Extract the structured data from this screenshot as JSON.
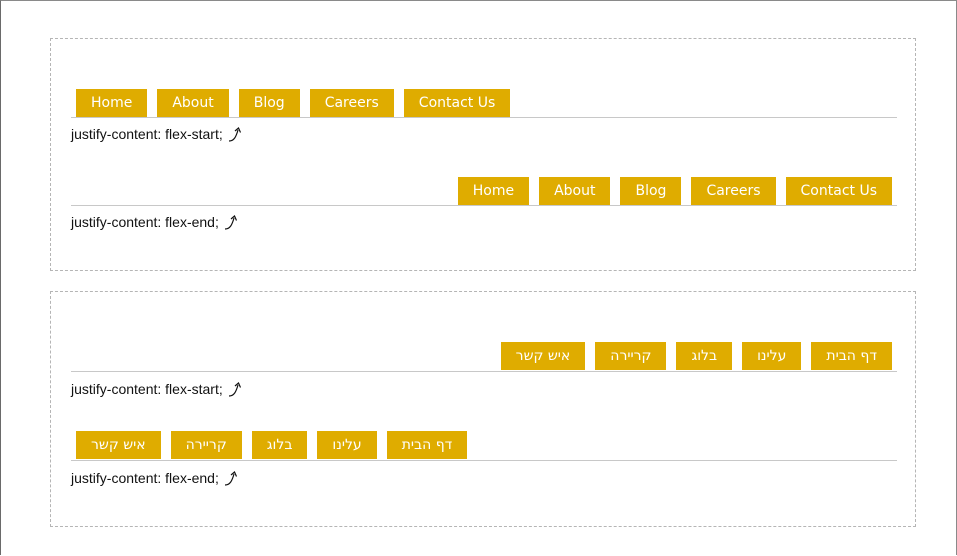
{
  "ltr_tabs": [
    "Home",
    "About",
    "Blog",
    "Careers",
    "Contact Us"
  ],
  "rtl_tabs": [
    "דף הבית",
    "עלינו",
    "בלוג",
    "קריירה",
    "איש קשר"
  ],
  "examples": {
    "ltr_start_caption": "justify-content: flex-start;",
    "ltr_end_caption": "justify-content: flex-end;",
    "rtl_start_caption": "justify-content: flex-start;",
    "rtl_end_caption": "justify-content: flex-end;"
  },
  "icons": {
    "caption_arrow": "curved-arrow-up-right-icon"
  },
  "colors": {
    "tab_background": "#dfac00",
    "tab_text": "#ffffff",
    "baseline": "#c8c8c8",
    "panel_border": "#b5b5b5"
  }
}
